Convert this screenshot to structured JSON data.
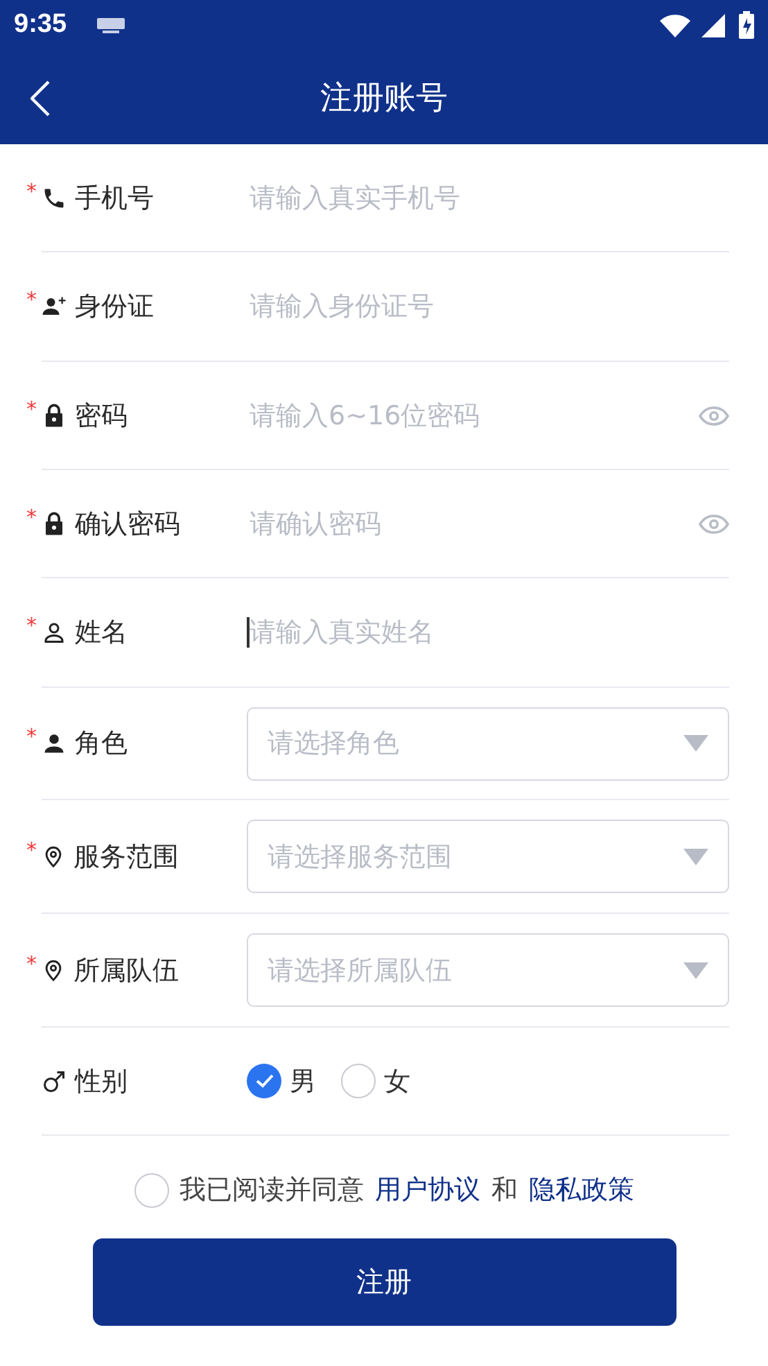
{
  "status_bar": {
    "time": "9:35"
  },
  "header": {
    "title": "注册账号"
  },
  "fields": [
    {
      "kind": "input",
      "mark": "*",
      "label": "手机号",
      "placeholder": "请输入真实手机号",
      "focused": false,
      "reveal_toggle": false
    },
    {
      "kind": "input",
      "mark": "*",
      "label": "身份证",
      "placeholder": "请输入身份证号",
      "focused": false,
      "reveal_toggle": false
    },
    {
      "kind": "input",
      "mark": "*",
      "label": "密码",
      "placeholder": "请输入6~16位密码",
      "focused": false,
      "reveal_toggle": true
    },
    {
      "kind": "input",
      "mark": "*",
      "label": "确认密码",
      "placeholder": "请确认密码",
      "focused": false,
      "reveal_toggle": true
    },
    {
      "kind": "input",
      "mark": "*",
      "label": "姓名",
      "placeholder": "请输入真实姓名",
      "focused": true,
      "reveal_toggle": false
    },
    {
      "kind": "select",
      "mark": "*",
      "label": "角色",
      "placeholder": "请选择角色"
    },
    {
      "kind": "select",
      "mark": "*",
      "label": "服务范围",
      "placeholder": "请选择服务范围"
    },
    {
      "kind": "select",
      "mark": "*",
      "label": "所属队伍",
      "placeholder": "请选择所属队伍"
    },
    {
      "kind": "radio",
      "label": "性别",
      "options": [
        {
          "label": "男",
          "selected": true
        },
        {
          "label": "女",
          "selected": false
        }
      ]
    }
  ],
  "agreement": {
    "checked": false,
    "text": "我已阅读并同意",
    "link_1": "用户协议",
    "joiner": "和",
    "link_2": "隐私政策"
  },
  "submit": {
    "label": "注册"
  }
}
